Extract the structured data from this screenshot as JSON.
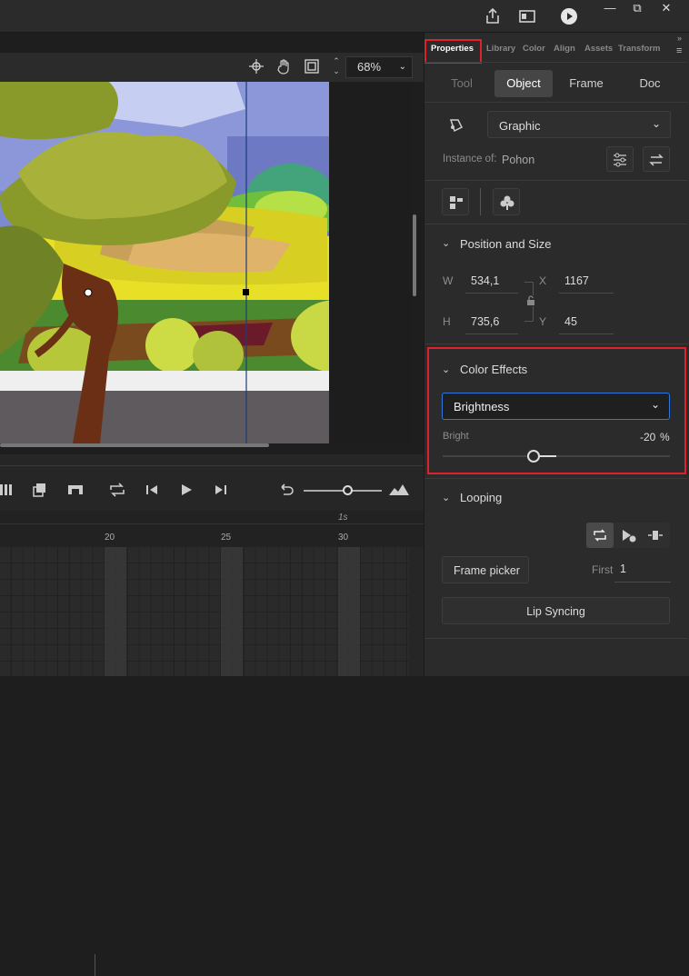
{
  "stage": {
    "zoom": "68%"
  },
  "panel": {
    "tabs": [
      "Properties",
      "Library",
      "Color",
      "Align",
      "Assets",
      "Transform"
    ],
    "subtabs": [
      "Tool",
      "Object",
      "Frame",
      "Doc"
    ],
    "symbol_type": "Graphic",
    "instance_label": "Instance of:",
    "instance_name": "Pohon",
    "position_size": {
      "title": "Position and Size",
      "w_label": "W",
      "w": "534,1",
      "h_label": "H",
      "h": "735,6",
      "x_label": "X",
      "x": "1167",
      "y_label": "Y",
      "y": "45"
    },
    "color_effects": {
      "title": "Color Effects",
      "mode": "Brightness",
      "bright_label": "Bright",
      "bright_value": "-20",
      "bright_unit": "%"
    },
    "looping": {
      "title": "Looping",
      "frame_picker": "Frame picker",
      "first_label": "First",
      "first_value": "1",
      "lip_syncing": "Lip Syncing"
    }
  },
  "timeline": {
    "ruler_marks": [
      "20",
      "25",
      "30"
    ],
    "seconds_mark": "1s"
  },
  "colors": {
    "accent_blue": "#2d77e0",
    "highlight_red": "#e0202a",
    "panel_bg": "#2b2b2b"
  }
}
